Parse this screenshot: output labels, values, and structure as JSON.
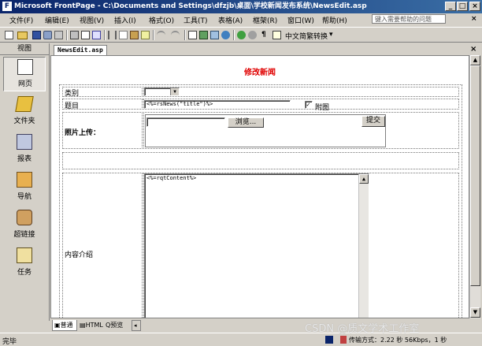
{
  "window": {
    "title": "Microsoft FrontPage - C:\\Documents and Settings\\dfzjb\\桌面\\学校新闻发布系统\\NewsEdit.asp",
    "app_icon": "frontpage-icon",
    "minimize": "_",
    "restore": "□",
    "close": "×"
  },
  "menu": {
    "items": [
      "文件(F)",
      "编辑(E)",
      "视图(V)",
      "插入(I)",
      "格式(O)",
      "工具(T)",
      "表格(A)",
      "框架(R)",
      "窗口(W)",
      "帮助(H)"
    ],
    "help_placeholder": "键入需要帮助的问题",
    "close": "×"
  },
  "toolbar": {
    "icons": [
      "new-icon",
      "open-icon",
      "save-icon",
      "publish-icon",
      "web-component-icon",
      "print-icon",
      "preview-icon",
      "spelling-icon",
      "cut-icon",
      "copy-icon",
      "paste-icon",
      "format-painter-icon",
      "undo-icon",
      "redo-icon",
      "table-icon",
      "picture-icon",
      "chart-icon",
      "hyperlink-icon",
      "refresh-icon",
      "stop-icon",
      "paragraph-icon",
      "help-icon"
    ],
    "convert_label": "中文简繁转换"
  },
  "views_panel": {
    "header": "视图",
    "items": [
      {
        "label": "网页",
        "icon": "page-icon",
        "active": true
      },
      {
        "label": "文件夹",
        "icon": "folder-icon",
        "active": false
      },
      {
        "label": "报表",
        "icon": "reports-icon",
        "active": false
      },
      {
        "label": "导航",
        "icon": "navigation-icon",
        "active": false
      },
      {
        "label": "超链接",
        "icon": "hyperlinks-icon",
        "active": false
      },
      {
        "label": "任务",
        "icon": "tasks-icon",
        "active": false
      }
    ]
  },
  "document_tab": {
    "label": "NewsEdit.asp",
    "close": "×"
  },
  "form": {
    "title": "修改新闻",
    "category_label": "类别",
    "title_label": "题目",
    "title_value": "<%=rsNews(\"title\")%>",
    "attach_label": "附图",
    "attach_checked": true,
    "photo_label": "照片上传：",
    "browse_button": "浏览...",
    "submit_button": "提交",
    "content_label": "内容介绍",
    "content_value": "<%=rqtContent%>"
  },
  "bottom_tabs": [
    {
      "label": "普通",
      "icon": "normal-view-icon",
      "active": true
    },
    {
      "label": "HTML",
      "icon": "html-view-icon",
      "active": false
    },
    {
      "label": "预览",
      "icon": "preview-view-icon",
      "active": false
    }
  ],
  "status": {
    "left": "完毕",
    "transfer": "传输方式：2.22 秒 56Kbps，1 秒"
  },
  "watermark": "CSDN @质文学术工作室"
}
